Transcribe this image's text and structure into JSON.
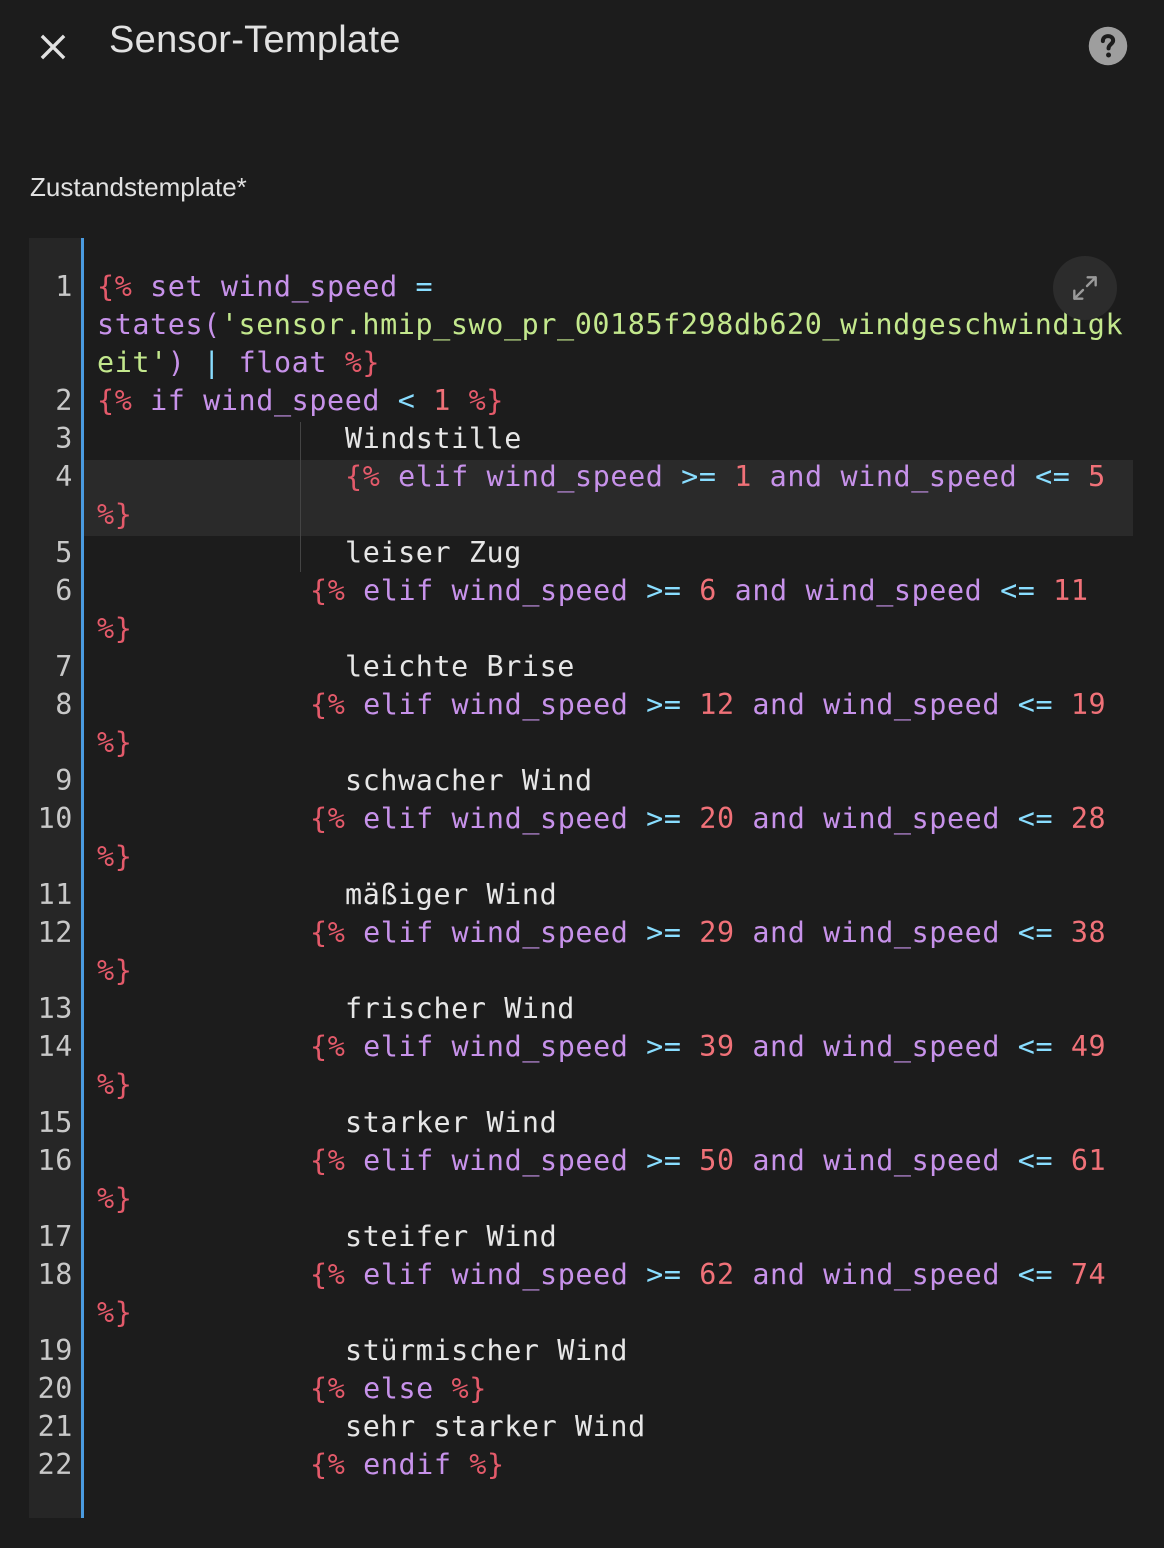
{
  "header": {
    "title": "Sensor-Template",
    "close_icon": "close-icon",
    "help_icon": "help-circle-icon"
  },
  "field": {
    "label": "Zustandstemplate*"
  },
  "editor": {
    "expand_icon": "fullscreen-expand-icon",
    "accent_color": "#4a9be0",
    "line_numbers": [
      "1",
      "2",
      "3",
      "4",
      "5",
      "6",
      "7",
      "8",
      "9",
      "10",
      "11",
      "12",
      "13",
      "14",
      "15",
      "16",
      "17",
      "18",
      "19",
      "20",
      "21",
      "22"
    ],
    "lines": {
      "l1a": [
        "{%",
        " set ",
        "wind_speed",
        " =",
        ""
      ],
      "l1b": [
        "states(",
        "'sensor.hmip_swo_pr_00185f298db620_windgeschwindigk"
      ],
      "l1c": [
        "eit'",
        ")",
        " | ",
        "float",
        " %}"
      ],
      "l2": [
        "{%",
        " if ",
        "wind_speed",
        " < ",
        "1",
        " %}"
      ],
      "l3": "Windstille",
      "l4a": [
        "{%",
        " elif ",
        "wind_speed",
        " >= ",
        "1",
        " and ",
        "wind_speed",
        " <= ",
        "5"
      ],
      "l4b": "%}",
      "l5": "leiser Zug",
      "l6a": [
        "{%",
        " elif ",
        "wind_speed",
        " >= ",
        "6",
        " and ",
        "wind_speed",
        " <= ",
        "11"
      ],
      "l6b": "%}",
      "l7": "leichte Brise",
      "l8a": [
        "{%",
        " elif ",
        "wind_speed",
        " >= ",
        "12",
        " and ",
        "wind_speed",
        " <= ",
        "19"
      ],
      "l8b": "%}",
      "l9": "schwacher Wind",
      "l10a": [
        "{%",
        " elif ",
        "wind_speed",
        " >= ",
        "20",
        " and ",
        "wind_speed",
        " <= ",
        "28"
      ],
      "l10b": "%}",
      "l11": "mäßiger Wind",
      "l12a": [
        "{%",
        " elif ",
        "wind_speed",
        " >= ",
        "29",
        " and ",
        "wind_speed",
        " <= ",
        "38"
      ],
      "l12b": "%}",
      "l13": "frischer Wind",
      "l14a": [
        "{%",
        " elif ",
        "wind_speed",
        " >= ",
        "39",
        " and ",
        "wind_speed",
        " <= ",
        "49"
      ],
      "l14b": "%}",
      "l15": "starker Wind",
      "l16a": [
        "{%",
        " elif ",
        "wind_speed",
        " >= ",
        "50",
        " and ",
        "wind_speed",
        " <= ",
        "61"
      ],
      "l16b": "%}",
      "l17": "steifer Wind",
      "l18a": [
        "{%",
        " elif ",
        "wind_speed",
        " >= ",
        "62",
        " and ",
        "wind_speed",
        " <= ",
        "74"
      ],
      "l18b": "%}",
      "l19": "stürmischer Wind",
      "l20": [
        "{%",
        " else ",
        "%}"
      ],
      "l21": "sehr starker Wind",
      "l22": [
        "{%",
        " endif ",
        "%}"
      ]
    }
  }
}
